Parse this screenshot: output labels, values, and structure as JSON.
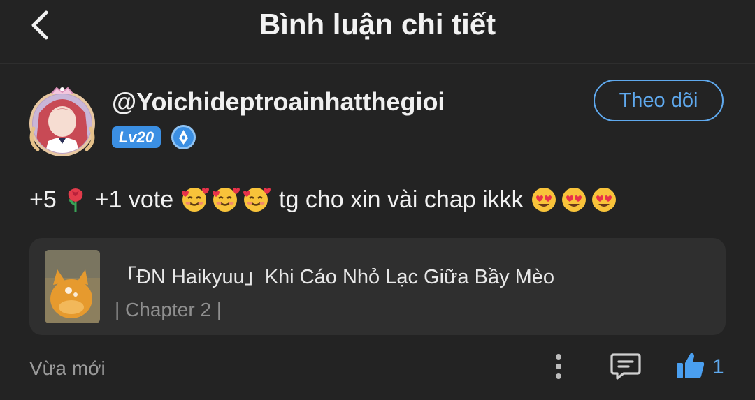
{
  "header": {
    "title": "Bình luận chi tiết",
    "back_icon": "chevron-left-icon"
  },
  "author": {
    "username": "@Yoichideptroainhatthegioi",
    "level": "Lv20",
    "badge_icon": "pen-badge-icon",
    "follow_label": "Theo dõi"
  },
  "comment": {
    "part1": "+5",
    "part2": " +1 vote ",
    "part3": " tg cho xin vài chap ikkk",
    "emoji_rose": "rose-emoji",
    "emoji_hearts": "smiling-face-with-hearts-emoji",
    "emoji_heart_eyes": "heart-eyes-emoji"
  },
  "story_card": {
    "title": "「ĐN Haikyuu」Khi Cáo Nhỏ Lạc Giữa Bầy Mèo",
    "chapter": "| Chapter 2 |"
  },
  "footer": {
    "time": "Vừa mới",
    "like_count": "1",
    "more_icon": "more-vertical-icon",
    "reply_icon": "comment-icon",
    "like_icon": "thumbs-up-icon"
  },
  "colors": {
    "background": "#232323",
    "card": "#2f2f2f",
    "accent": "#5fa9ee",
    "level_badge": "#3b8fe3"
  }
}
